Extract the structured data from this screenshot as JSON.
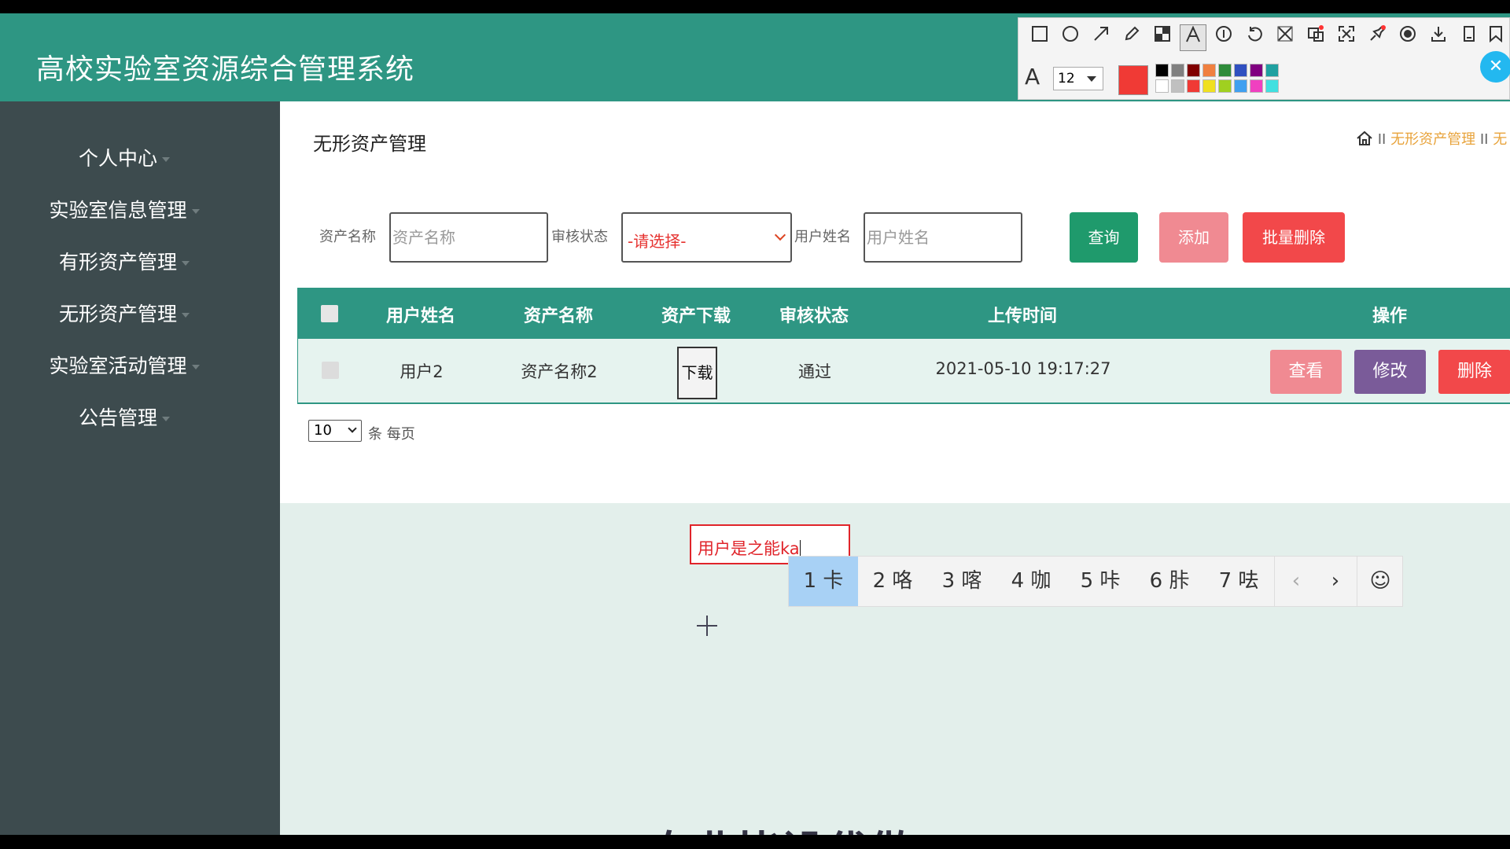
{
  "app": {
    "title": "高校实验室资源综合管理系统"
  },
  "sidebar": {
    "items": [
      {
        "label": "个人中心"
      },
      {
        "label": "实验室信息管理"
      },
      {
        "label": "有形资产管理"
      },
      {
        "label": "无形资产管理"
      },
      {
        "label": "实验室活动管理"
      },
      {
        "label": "公告管理"
      }
    ]
  },
  "page": {
    "title": "无形资产管理",
    "breadcrumb": {
      "separator": "II",
      "current": "无形资产管理",
      "trailing": "无"
    }
  },
  "search": {
    "asset_name_label": "资产名称",
    "asset_name_placeholder": "资产名称",
    "review_status_label": "审核状态",
    "review_status_value": "-请选择-",
    "user_name_label": "用户姓名",
    "user_name_placeholder": "用户姓名"
  },
  "buttons": {
    "query": "查询",
    "add": "添加",
    "batch_delete": "批量删除"
  },
  "colors": {
    "header": "#2e9683",
    "sidebar": "#3d4b4e",
    "query": "#1f9a6c",
    "add": "#f08a92",
    "batch_delete": "#f2484a",
    "view": "#f08a92",
    "edit": "#7a5b99",
    "delete": "#f2484a"
  },
  "table": {
    "columns": [
      "用户姓名",
      "资产名称",
      "资产下载",
      "审核状态",
      "上传时间",
      "操作"
    ],
    "rows": [
      {
        "user_name": "用户2",
        "asset_name": "资产名称2",
        "download": "下载",
        "status": "通过",
        "upload_time": "2021-05-10 19:17:27",
        "actions": {
          "view": "查看",
          "edit": "修改",
          "delete": "删除"
        }
      }
    ]
  },
  "pagination": {
    "page_size": "10",
    "page_size_label": "条 每页"
  },
  "annotation": {
    "text": "用户是之能ka"
  },
  "ime": {
    "candidates": [
      {
        "num": "1",
        "char": "卡"
      },
      {
        "num": "2",
        "char": "咯"
      },
      {
        "num": "3",
        "char": "喀"
      },
      {
        "num": "4",
        "char": "咖"
      },
      {
        "num": "5",
        "char": "咔"
      },
      {
        "num": "6",
        "char": "胩"
      },
      {
        "num": "7",
        "char": "呿"
      }
    ],
    "prev": "‹",
    "next": "›",
    "emoji": "☺"
  },
  "toolbar": {
    "icons": [
      "rectangle-icon",
      "ellipse-icon",
      "arrow-icon",
      "pencil-icon",
      "mosaic-icon",
      "text-icon",
      "number-icon",
      "undo-icon",
      "cut-icon",
      "translate-icon",
      "expand-icon",
      "pin-icon",
      "record-icon",
      "download-icon",
      "save-icon",
      "bookmark-icon"
    ],
    "font_glyph": "A",
    "font_size": "12",
    "current_color": "#f03a35",
    "palette": [
      "#000000",
      "#808080",
      "#800000",
      "#f08040",
      "#2e8b3a",
      "#3050c0",
      "#800080",
      "#20a0a0",
      "#ffffff",
      "#c0c0c0",
      "#f03a35",
      "#f0e020",
      "#a0d020",
      "#40a0f0",
      "#f040c0",
      "#40e0e0"
    ]
  },
  "footer": {
    "partial_text": "专业毕设代做"
  }
}
